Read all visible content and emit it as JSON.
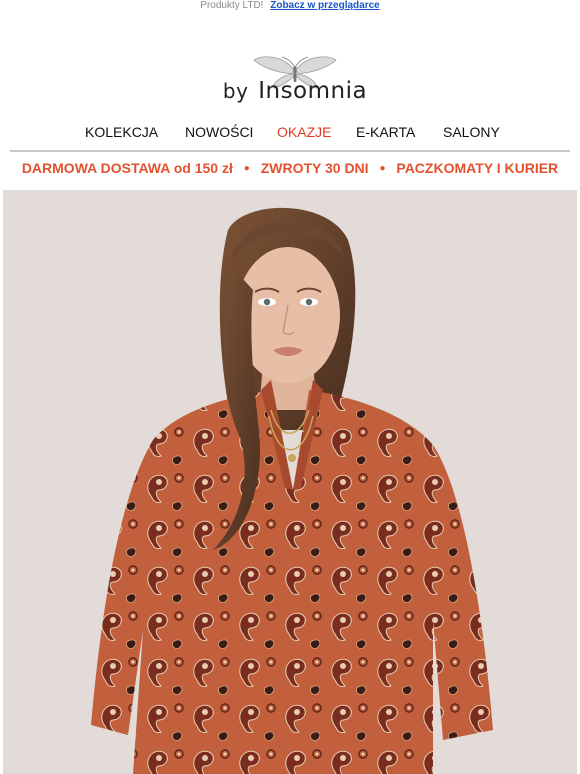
{
  "preheader": {
    "brand_text": "Produkty LTD!",
    "view_link": "Zobacz w przeglądarce"
  },
  "logo": {
    "by": "by",
    "name": "Insomnia"
  },
  "nav": {
    "items": [
      {
        "label": "KOLEKCJA"
      },
      {
        "label": "NOWOŚCI"
      },
      {
        "label": "OKAZJE"
      },
      {
        "label": "E-KARTA"
      },
      {
        "label": "SALONY"
      }
    ]
  },
  "promo": {
    "items": [
      "DARMOWA DOSTAWA od 150 zł",
      "ZWROTY 30 DNI",
      "PACZKOMATY I KURIER"
    ],
    "separator": "●"
  },
  "colors": {
    "accent_red": "#e23a24",
    "promo_orange": "#e4512f",
    "link_blue": "#1a55c8",
    "blouse": "#c2603d"
  },
  "hero": {
    "image": "model-in-paisley-blouse"
  }
}
